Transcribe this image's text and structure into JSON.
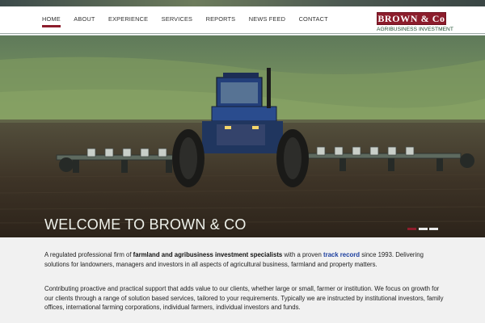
{
  "nav": {
    "items": [
      "HOME",
      "ABOUT",
      "EXPERIENCE",
      "SERVICES",
      "REPORTS",
      "NEWS FEED",
      "CONTACT"
    ],
    "active": "HOME"
  },
  "logo": {
    "name": "BROWN & Co",
    "tagline": "AGRIBUSINESS INVESTMENT"
  },
  "hero": {
    "heading": "WELCOME TO BROWN & CO",
    "slide_count": 3,
    "active_slide": 1
  },
  "intro": {
    "p1_prefix": "A regulated professional firm of ",
    "p1_bold": "farmland and agribusiness investment specialists",
    "p1_mid": " with a proven ",
    "p1_link": "track record",
    "p1_suffix": " since 1993. Delivering solutions for landowners, managers and investors in all aspects of agricultural business, farmland and property matters.",
    "p2": "Contributing proactive and practical support that adds value to our clients, whether large or small, farmer or institution. We focus on growth for our clients through a range of solution based services, tailored to your requirements. Typically we are instructed by institutional investors, family offices, international farming corporations, individual farmers, individual investors and funds."
  },
  "colors": {
    "brand": "#8c1d2c",
    "logo_green": "#1f4f32",
    "link": "#1a3d9e"
  }
}
